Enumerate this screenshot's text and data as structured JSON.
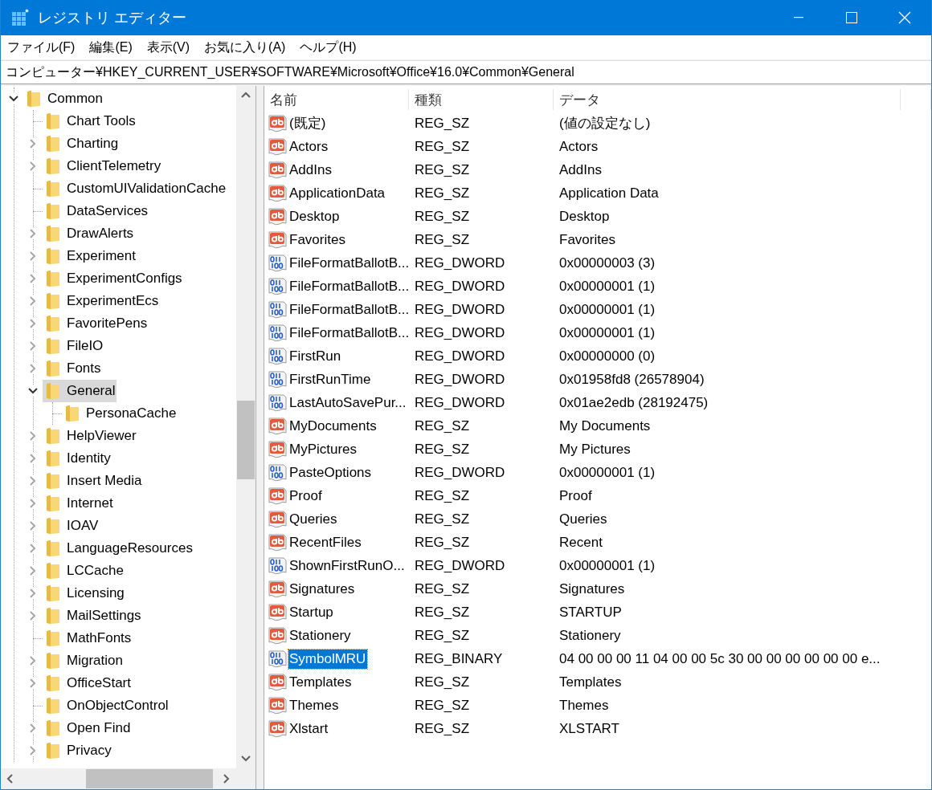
{
  "window": {
    "title": "レジストリ エディター"
  },
  "menu": [
    {
      "label": "ファイル(F)"
    },
    {
      "label": "編集(E)"
    },
    {
      "label": "表示(V)"
    },
    {
      "label": "お気に入り(A)"
    },
    {
      "label": "ヘルプ(H)"
    }
  ],
  "address": {
    "value": "コンピューター¥HKEY_CURRENT_USER¥SOFTWARE¥Microsoft¥Office¥16.0¥Common¥General"
  },
  "tree": {
    "items": [
      {
        "label": "Common",
        "expandable": true,
        "expanded": true,
        "selected": false,
        "children": [
          {
            "label": "Chart Tools",
            "expandable": false,
            "selected": false
          },
          {
            "label": "Charting",
            "expandable": true,
            "expanded": false,
            "selected": false
          },
          {
            "label": "ClientTelemetry",
            "expandable": true,
            "expanded": false,
            "selected": false
          },
          {
            "label": "CustomUIValidationCache",
            "expandable": false,
            "selected": false
          },
          {
            "label": "DataServices",
            "expandable": false,
            "selected": false
          },
          {
            "label": "DrawAlerts",
            "expandable": true,
            "expanded": false,
            "selected": false
          },
          {
            "label": "Experiment",
            "expandable": true,
            "expanded": false,
            "selected": false
          },
          {
            "label": "ExperimentConfigs",
            "expandable": true,
            "expanded": false,
            "selected": false
          },
          {
            "label": "ExperimentEcs",
            "expandable": true,
            "expanded": false,
            "selected": false
          },
          {
            "label": "FavoritePens",
            "expandable": true,
            "expanded": false,
            "selected": false
          },
          {
            "label": "FileIO",
            "expandable": true,
            "expanded": false,
            "selected": false
          },
          {
            "label": "Fonts",
            "expandable": true,
            "expanded": false,
            "selected": false
          },
          {
            "label": "General",
            "expandable": true,
            "expanded": true,
            "selected": true,
            "children": [
              {
                "label": "PersonaCache",
                "expandable": false,
                "selected": false
              }
            ]
          },
          {
            "label": "HelpViewer",
            "expandable": true,
            "expanded": false,
            "selected": false
          },
          {
            "label": "Identity",
            "expandable": true,
            "expanded": false,
            "selected": false
          },
          {
            "label": "Insert Media",
            "expandable": true,
            "expanded": false,
            "selected": false
          },
          {
            "label": "Internet",
            "expandable": true,
            "expanded": false,
            "selected": false
          },
          {
            "label": "IOAV",
            "expandable": true,
            "expanded": false,
            "selected": false
          },
          {
            "label": "LanguageResources",
            "expandable": true,
            "expanded": false,
            "selected": false
          },
          {
            "label": "LCCache",
            "expandable": true,
            "expanded": false,
            "selected": false
          },
          {
            "label": "Licensing",
            "expandable": true,
            "expanded": false,
            "selected": false
          },
          {
            "label": "MailSettings",
            "expandable": true,
            "expanded": false,
            "selected": false
          },
          {
            "label": "MathFonts",
            "expandable": false,
            "selected": false
          },
          {
            "label": "Migration",
            "expandable": true,
            "expanded": false,
            "selected": false
          },
          {
            "label": "OfficeStart",
            "expandable": true,
            "expanded": false,
            "selected": false
          },
          {
            "label": "OnObjectControl",
            "expandable": false,
            "selected": false
          },
          {
            "label": "Open Find",
            "expandable": true,
            "expanded": false,
            "selected": false
          },
          {
            "label": "Privacy",
            "expandable": true,
            "expanded": false,
            "selected": false
          }
        ]
      }
    ]
  },
  "values": {
    "columns": [
      "名前",
      "種類",
      "データ"
    ],
    "rows": [
      {
        "kind": "string",
        "name": "(既定)",
        "type": "REG_SZ",
        "data": "(値の設定なし)",
        "selected": false
      },
      {
        "kind": "string",
        "name": "Actors",
        "type": "REG_SZ",
        "data": "Actors",
        "selected": false
      },
      {
        "kind": "string",
        "name": "AddIns",
        "type": "REG_SZ",
        "data": "AddIns",
        "selected": false
      },
      {
        "kind": "string",
        "name": "ApplicationData",
        "type": "REG_SZ",
        "data": "Application Data",
        "selected": false
      },
      {
        "kind": "string",
        "name": "Desktop",
        "type": "REG_SZ",
        "data": "Desktop",
        "selected": false
      },
      {
        "kind": "string",
        "name": "Favorites",
        "type": "REG_SZ",
        "data": "Favorites",
        "selected": false
      },
      {
        "kind": "binary",
        "name": "FileFormatBallotB...",
        "type": "REG_DWORD",
        "data": "0x00000003 (3)",
        "selected": false
      },
      {
        "kind": "binary",
        "name": "FileFormatBallotB...",
        "type": "REG_DWORD",
        "data": "0x00000001 (1)",
        "selected": false
      },
      {
        "kind": "binary",
        "name": "FileFormatBallotB...",
        "type": "REG_DWORD",
        "data": "0x00000001 (1)",
        "selected": false
      },
      {
        "kind": "binary",
        "name": "FileFormatBallotB...",
        "type": "REG_DWORD",
        "data": "0x00000001 (1)",
        "selected": false
      },
      {
        "kind": "binary",
        "name": "FirstRun",
        "type": "REG_DWORD",
        "data": "0x00000000 (0)",
        "selected": false
      },
      {
        "kind": "binary",
        "name": "FirstRunTime",
        "type": "REG_DWORD",
        "data": "0x01958fd8 (26578904)",
        "selected": false
      },
      {
        "kind": "binary",
        "name": "LastAutoSavePur...",
        "type": "REG_DWORD",
        "data": "0x01ae2edb (28192475)",
        "selected": false
      },
      {
        "kind": "string",
        "name": "MyDocuments",
        "type": "REG_SZ",
        "data": "My Documents",
        "selected": false
      },
      {
        "kind": "string",
        "name": "MyPictures",
        "type": "REG_SZ",
        "data": "My Pictures",
        "selected": false
      },
      {
        "kind": "binary",
        "name": "PasteOptions",
        "type": "REG_DWORD",
        "data": "0x00000001 (1)",
        "selected": false
      },
      {
        "kind": "string",
        "name": "Proof",
        "type": "REG_SZ",
        "data": "Proof",
        "selected": false
      },
      {
        "kind": "string",
        "name": "Queries",
        "type": "REG_SZ",
        "data": "Queries",
        "selected": false
      },
      {
        "kind": "string",
        "name": "RecentFiles",
        "type": "REG_SZ",
        "data": "Recent",
        "selected": false
      },
      {
        "kind": "binary",
        "name": "ShownFirstRunO...",
        "type": "REG_DWORD",
        "data": "0x00000001 (1)",
        "selected": false
      },
      {
        "kind": "string",
        "name": "Signatures",
        "type": "REG_SZ",
        "data": "Signatures",
        "selected": false
      },
      {
        "kind": "string",
        "name": "Startup",
        "type": "REG_SZ",
        "data": "STARTUP",
        "selected": false
      },
      {
        "kind": "string",
        "name": "Stationery",
        "type": "REG_SZ",
        "data": "Stationery",
        "selected": false
      },
      {
        "kind": "binary",
        "name": "SymbolMRU",
        "type": "REG_BINARY",
        "data": "04 00 00 00 11 04 00 00 5c 30 00 00 00 00 00 00 e...",
        "selected": true
      },
      {
        "kind": "string",
        "name": "Templates",
        "type": "REG_SZ",
        "data": "Templates",
        "selected": false
      },
      {
        "kind": "string",
        "name": "Themes",
        "type": "REG_SZ",
        "data": "Themes",
        "selected": false
      },
      {
        "kind": "string",
        "name": "Xlstart",
        "type": "REG_SZ",
        "data": "XLSTART",
        "selected": false
      }
    ]
  }
}
